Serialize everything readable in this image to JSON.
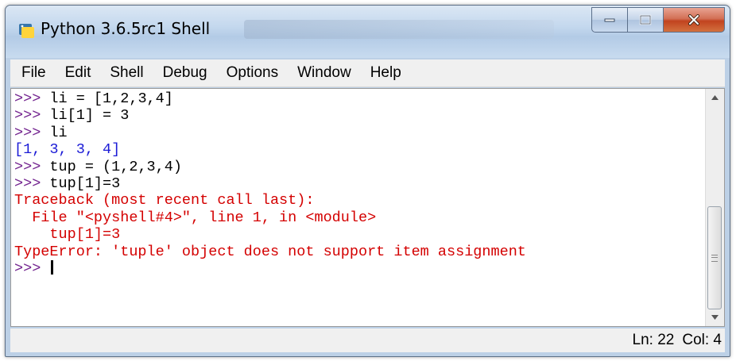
{
  "window": {
    "title": "Python 3.6.5rc1 Shell"
  },
  "menu": [
    "File",
    "Edit",
    "Shell",
    "Debug",
    "Options",
    "Window",
    "Help"
  ],
  "shell_lines": [
    {
      "prompt": ">>> ",
      "text": "li = [1,2,3,4]",
      "kind": "input"
    },
    {
      "prompt": ">>> ",
      "text": "li[1] = 3",
      "kind": "input"
    },
    {
      "prompt": ">>> ",
      "text": "li",
      "kind": "input"
    },
    {
      "prompt": "",
      "text": "[1, 3, 3, 4]",
      "kind": "output"
    },
    {
      "prompt": ">>> ",
      "text": "tup = (1,2,3,4)",
      "kind": "input"
    },
    {
      "prompt": ">>> ",
      "text": "tup[1]=3",
      "kind": "input"
    },
    {
      "prompt": "",
      "text": "Traceback (most recent call last):",
      "kind": "error"
    },
    {
      "prompt": "",
      "text": "  File \"<pyshell#4>\", line 1, in <module>",
      "kind": "error"
    },
    {
      "prompt": "",
      "text": "    tup[1]=3",
      "kind": "error"
    },
    {
      "prompt": "",
      "text": "TypeError: 'tuple' object does not support item assignment",
      "kind": "error"
    },
    {
      "prompt": ">>> ",
      "text": "",
      "kind": "current"
    }
  ],
  "status": {
    "ln": "Ln: 22",
    "col": "Col: 4"
  },
  "colors": {
    "prompt": "#742590",
    "output": "#1b1bd6",
    "error": "#d40000"
  }
}
